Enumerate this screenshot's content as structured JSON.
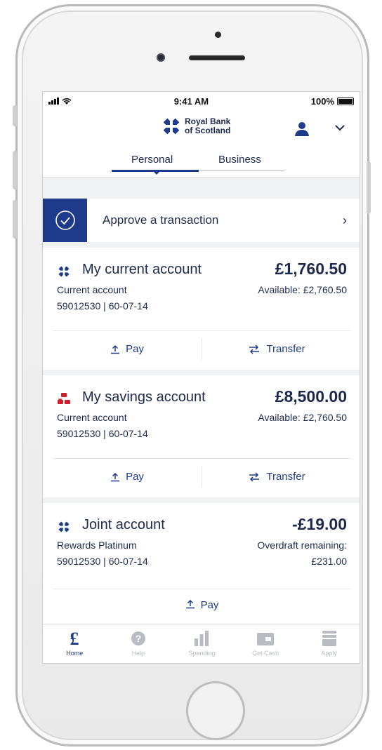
{
  "status_bar": {
    "time": "9:41 AM",
    "battery": "100%"
  },
  "brand": {
    "line1": "Royal Bank",
    "line2": "of Scotland"
  },
  "tabs": [
    {
      "label": "Personal",
      "active": true
    },
    {
      "label": "Business",
      "active": false
    }
  ],
  "approve": {
    "label": "Approve a transaction"
  },
  "accounts": [
    {
      "name": "My current account",
      "balance": "£1,760.50",
      "type": "Current account",
      "number": "59012530 | 60-07-14",
      "available": "Available: £2,760.50",
      "icon": "rbs-logo-icon",
      "actions": [
        {
          "label": "Pay",
          "icon": "pay-icon"
        },
        {
          "label": "Transfer",
          "icon": "transfer-icon"
        }
      ]
    },
    {
      "name": "My savings account",
      "balance": "£8,500.00",
      "type": "Current account",
      "number": "59012530 | 60-07-14",
      "available": "Available: £2,760.50",
      "icon": "natwest-logo-icon",
      "actions": [
        {
          "label": "Pay",
          "icon": "pay-icon"
        },
        {
          "label": "Transfer",
          "icon": "transfer-icon"
        }
      ]
    },
    {
      "name": "Joint account",
      "balance": "-£19.00",
      "type": "Rewards Platinum",
      "number": "59012530 | 60-07-14",
      "available": "Overdraft remaining:",
      "available2": "£231.00",
      "icon": "rbs-logo-icon",
      "actions": [
        {
          "label": "Pay",
          "icon": "pay-icon"
        }
      ]
    }
  ],
  "bottom_nav": [
    {
      "label": "Home",
      "icon": "pound-icon",
      "active": true
    },
    {
      "label": "Help",
      "icon": "help-icon",
      "active": false
    },
    {
      "label": "Spending",
      "icon": "bar-chart-icon",
      "active": false
    },
    {
      "label": "Get Cash",
      "icon": "cash-icon",
      "active": false
    },
    {
      "label": "Apply",
      "icon": "apply-icon",
      "active": false
    }
  ],
  "colors": {
    "brand_navy": "#1d3b8a",
    "text_navy": "#1d2a4d",
    "natwest_red": "#d0202e",
    "screen_bg": "#f1f2f3"
  }
}
